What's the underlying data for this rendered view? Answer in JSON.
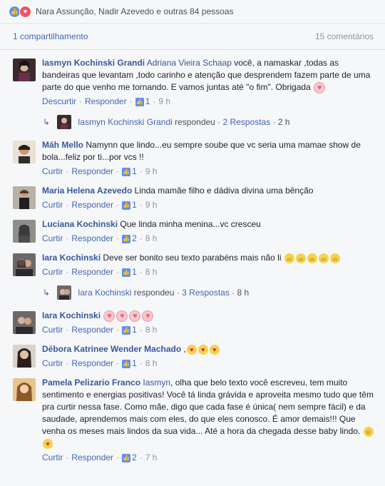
{
  "header": {
    "reaction_icons": [
      "like-icon",
      "love-icon"
    ],
    "reactors_text": "Nara Assunção, Nadir Azevedo e outras 84 pessoas",
    "shares": "1 compartilhamento",
    "comments_count": "15 comentários"
  },
  "actions": {
    "like": "Curtir",
    "unlike": "Descurtir",
    "reply": "Responder"
  },
  "comments": [
    {
      "author": "Iasmyn Kochinski Grandi",
      "mention": "Adriana Vieira Schaap",
      "text": " você, a namaskar ,todas as bandeiras que levantam ,todo carinho e atenção que desprendem fazem parte de uma parte do que venho me tornando. E vamos juntas até \"o fim\". Obrigada ",
      "likes": "1",
      "time": "9 h",
      "reply_summary": {
        "name": "Iasmyn Kochinski Grandi",
        "verb": " respondeu · ",
        "link": "2 Respostas",
        "time": " · 2 h"
      }
    },
    {
      "author": "Máh Mello",
      "text": " Namynn que lindo...eu sempre soube que vc seria uma mamae show de bola...feliz por ti...por vcs !!",
      "likes": "1",
      "time": "9 h"
    },
    {
      "author": "Maria Helena Azevedo",
      "text": " Linda mamãe filho e dádiva divina uma bênção",
      "likes": "1",
      "time": "9 h"
    },
    {
      "author": "Luciana Kochinski",
      "text": " Que linda minha menina...vc cresceu",
      "likes": "2",
      "time": "8 h"
    },
    {
      "author": "Iara Kochinski",
      "text": " Deve ser bonito seu texto parabéns mais não li ",
      "likes": "1",
      "time": "8 h",
      "reply_summary": {
        "name": "Iara Kochinski",
        "verb": " respondeu · ",
        "link": "3 Respostas",
        "time": " · 8 h"
      }
    },
    {
      "author": "Iara Kochinski",
      "text": " ",
      "likes": "1",
      "time": "8 h"
    },
    {
      "author": "Débora Katrinee Wender Machado",
      "text": " ,",
      "likes": "1",
      "time": "8 h"
    },
    {
      "author": "Pamela Pelizario Franco",
      "mention": "Iasmyn",
      "text": ", olha que belo texto você escreveu, tem muito sentimento e energias positivas! Você tá linda grávida e aproveita mesmo tudo que têm pra curtir nessa fase. Como mãe, digo que cada fase é única( nem sempre fácil) e da saudade, aprendemos mais com eles, do que eles conosco. É amor demais!!! Que venha os meses mais lindos da sua vida... Até a hora da chegada desse baby lindo. ",
      "likes": "2",
      "time": "7 h"
    }
  ],
  "colors": {
    "link": "#4267b2",
    "author": "#365899",
    "meta": "#90949c",
    "background": "#f6f7f9"
  }
}
